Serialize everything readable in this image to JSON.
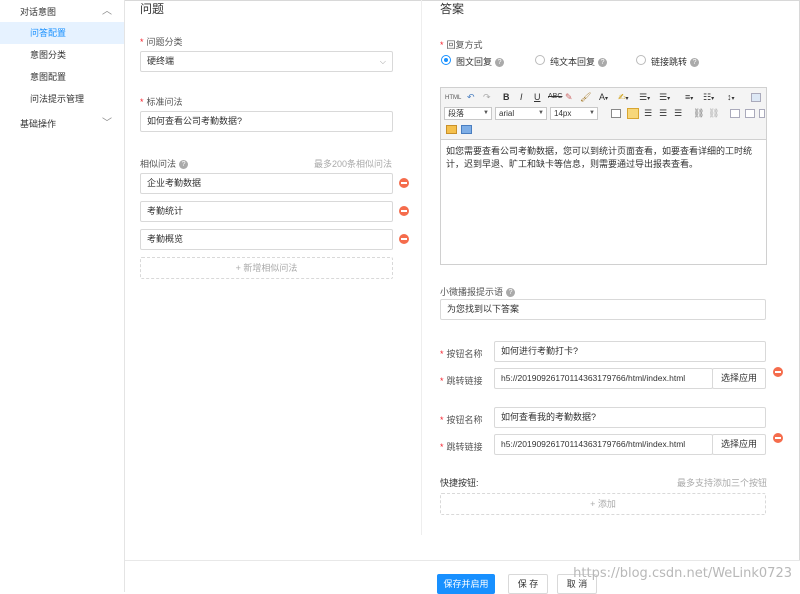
{
  "sidebar": {
    "group1": "对话意图",
    "items": [
      "问答配置",
      "意图分类",
      "意图配置",
      "问法提示管理"
    ],
    "group2": "基础操作"
  },
  "question": {
    "title": "问题",
    "category_label": "问题分类",
    "category_value": "硬终端",
    "standard_label": "标准问法",
    "standard_value": "如何查看公司考勤数据?",
    "similar_label": "相似问法",
    "similar_limit": "最多200条相似问法",
    "similar_items": [
      "企业考勤数据",
      "考勤统计",
      "考勤概览"
    ],
    "add_similar": "+ 新增相似问法"
  },
  "answer": {
    "title": "答案",
    "reply_mode_label": "回复方式",
    "reply_options": [
      "图文回复",
      "纯文本回复",
      "链接跳转"
    ],
    "selected_option": 0,
    "editor": {
      "para_select": "段落",
      "font_select": "arial",
      "size_select": "14px",
      "content": "如您需要查看公司考勤数据，您可以到统计页面查看，如要查看详细的工时统计，迟到早退、旷工和缺卡等信息，则需要通过导出报表查看。"
    },
    "hint_label": "小微播报提示语",
    "hint_value": "为您找到以下答案",
    "buttons": [
      {
        "name_label": "按钮名称",
        "name_value": "如何进行考勤打卡?",
        "link_label": "跳转链接",
        "link_value": "h5://20190926170114363179766/html/index.html",
        "choose": "选择应用"
      },
      {
        "name_label": "按钮名称",
        "name_value": "如何查看我的考勤数据?",
        "link_label": "跳转链接",
        "link_value": "h5://20190926170114363179766/html/index.html",
        "choose": "选择应用"
      }
    ],
    "quick_label": "快捷按钮:",
    "quick_limit": "最多支持添加三个按钮",
    "quick_add": "+ 添加"
  },
  "footer": {
    "save_enable": "保存并启用",
    "save": "保 存",
    "cancel": "取 消"
  },
  "watermark": "https://blog.csdn.net/WeLink0723",
  "colors": {
    "accent": "#1890ff",
    "danger": "#f56c4c",
    "required": "#f5222d"
  }
}
